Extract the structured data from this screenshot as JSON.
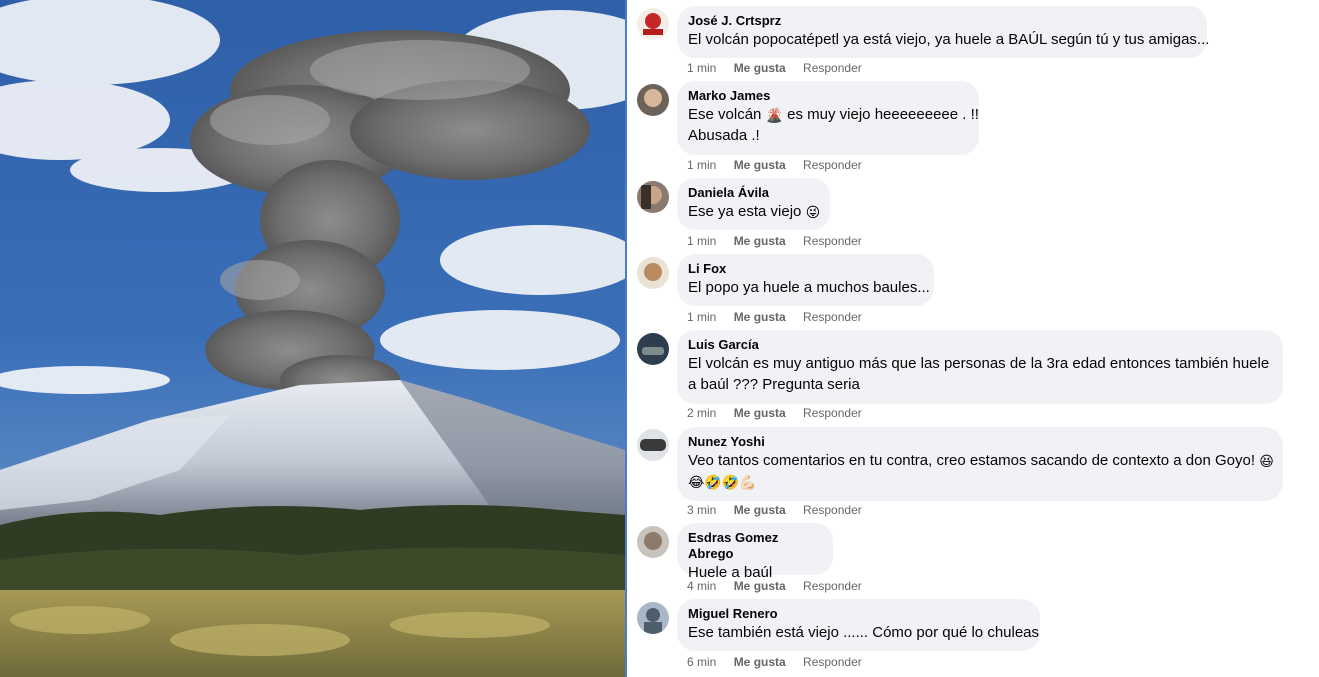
{
  "photo": {
    "subject": "volcano-eruption-photo"
  },
  "colors": {
    "bubble": "#f0f2f5",
    "meta": "#65676b",
    "divider": "#4a7cc8"
  },
  "comments": [
    {
      "author": "José J. Crtsprz",
      "lines": [
        "El volcán popocatépetl ya está viejo, ya huele a BAÚL según tú y tus amigas..."
      ],
      "time": "1 min",
      "like": "Me gusta",
      "reply": "Responder"
    },
    {
      "author": "Marko James",
      "lines": [
        "Ese volcán",
        "es muy viejo heeeeeeeee . !!",
        "Abusada .!"
      ],
      "time": "1 min",
      "like": "Me gusta",
      "reply": "Responder"
    },
    {
      "author": "Daniela Ávila",
      "lines": [
        "Ese ya esta viejo"
      ],
      "time": "1 min",
      "like": "Me gusta",
      "reply": "Responder"
    },
    {
      "author": "Li Fox",
      "lines": [
        "El popo ya huele a muchos baules..."
      ],
      "time": "1 min",
      "like": "Me gusta",
      "reply": "Responder"
    },
    {
      "author": "Luis García",
      "lines": [
        "El volcán es muy antiguo más que las personas de la 3ra edad entonces también huele",
        "a baúl ??? Pregunta seria"
      ],
      "time": "2 min",
      "like": "Me gusta",
      "reply": "Responder"
    },
    {
      "author": "Nunez Yoshi",
      "lines": [
        "Veo tantos comentarios en tu contra, creo estamos sacando de contexto a don Goyo!"
      ],
      "time": "3 min",
      "like": "Me gusta",
      "reply": "Responder"
    },
    {
      "author": "Esdras Gomez Abrego",
      "lines": [
        "Huele a baúl"
      ],
      "time": "4 min",
      "like": "Me gusta",
      "reply": "Responder"
    },
    {
      "author": "Miguel Renero",
      "lines": [
        "Ese también está viejo ...... Cómo por qué lo chuleas"
      ],
      "time": "6 min",
      "like": "Me gusta",
      "reply": "Responder"
    }
  ]
}
